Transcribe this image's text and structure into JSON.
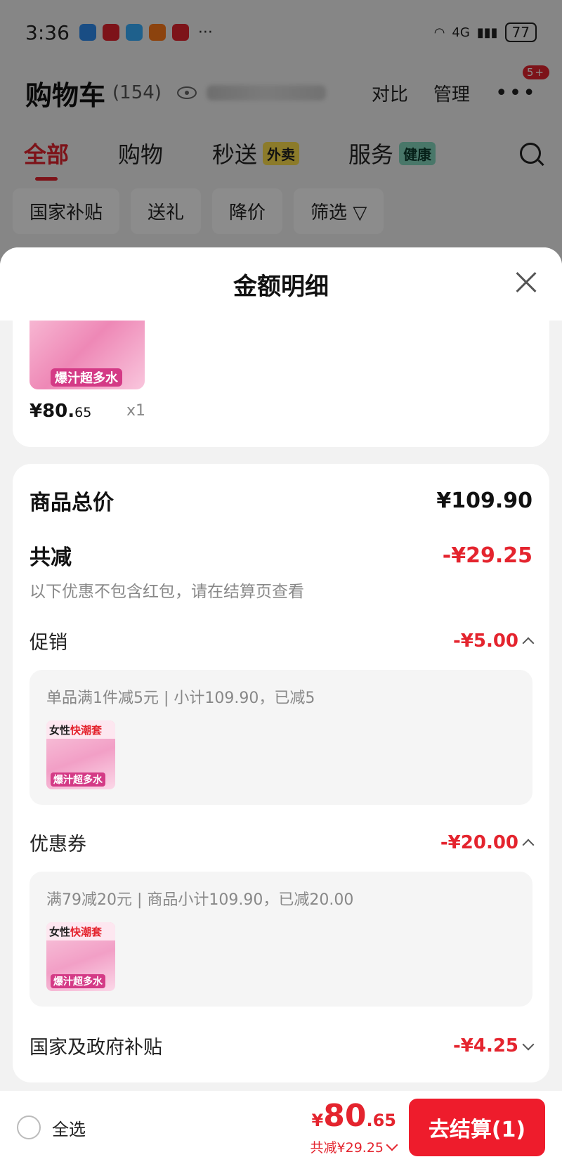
{
  "status_bar": {
    "time": "3:36",
    "more": "···",
    "network": "4G",
    "battery": "77"
  },
  "cart_header": {
    "title": "购物车",
    "count": "(154)",
    "compare": "对比",
    "manage": "管理",
    "more_badge": "5+"
  },
  "tabs": [
    {
      "label": "全部",
      "tag": ""
    },
    {
      "label": "购物",
      "tag": ""
    },
    {
      "label": "秒送",
      "tag": "外卖"
    },
    {
      "label": "服务",
      "tag": "健康"
    }
  ],
  "filters": [
    "国家补贴",
    "送礼",
    "降价",
    "筛选"
  ],
  "sheet": {
    "title": "金额明细"
  },
  "product": {
    "price_main": "¥80.",
    "price_cents": "65",
    "qty": "x1",
    "thumb_text": "爆汁超多水"
  },
  "summary": {
    "total_label": "商品总价",
    "total_value": "¥109.90",
    "discount_label": "共减",
    "discount_value": "-¥29.25",
    "note": "以下优惠不包含红包，请在结算页查看"
  },
  "promotion": {
    "label": "促销",
    "amount": "-¥5.00",
    "desc": "单品满1件减5元 | 小计109.90，已减5",
    "thumb_top_a": "女性",
    "thumb_top_b": "快潮套",
    "thumb_bottom": "爆汁超多水"
  },
  "coupon": {
    "label": "优惠券",
    "amount": "-¥20.00",
    "desc": "满79减20元 | 商品小计109.90，已减20.00",
    "thumb_top_a": "女性",
    "thumb_top_b": "快潮套",
    "thumb_bottom": "爆汁超多水"
  },
  "subsidy": {
    "label": "国家及政府补贴",
    "amount": "-¥4.25"
  },
  "bottom_bar": {
    "select_all": "全选",
    "price_yen": "¥",
    "price_main": "80",
    "price_cents": ".65",
    "discount": "共减¥29.25",
    "checkout": "去结算(1)"
  },
  "colors": {
    "accent_red": "#e4242e",
    "button_red": "#ee1c2c"
  }
}
